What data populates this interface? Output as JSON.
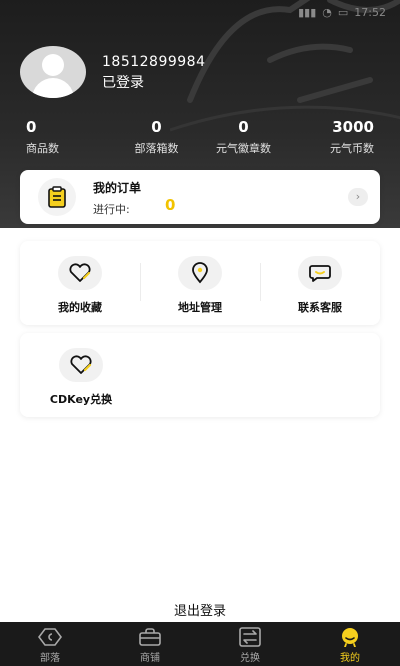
{
  "status": {
    "time": "17:52"
  },
  "profile": {
    "phone": "18512899984",
    "login_state": "已登录"
  },
  "stats": [
    {
      "value": "0",
      "label": "商品数"
    },
    {
      "value": "0",
      "label": "部落箱数"
    },
    {
      "value": "0",
      "label": "元气徽章数"
    },
    {
      "value": "3000",
      "label": "元气币数"
    }
  ],
  "order": {
    "title": "我的订单",
    "progress_label": "进行中:",
    "progress_count": "0"
  },
  "shortcuts": [
    {
      "label": "我的收藏",
      "icon": "heart-icon"
    },
    {
      "label": "地址管理",
      "icon": "location-pin-icon"
    },
    {
      "label": "联系客服",
      "icon": "chat-bubble-icon"
    }
  ],
  "cdkey": {
    "label": "CDKey兑换",
    "icon": "heart-icon"
  },
  "logout_label": "退出登录",
  "tabbar": [
    {
      "label": "部落",
      "icon": "tribe-icon",
      "active": false
    },
    {
      "label": "商铺",
      "icon": "shop-bag-icon",
      "active": false
    },
    {
      "label": "兑换",
      "icon": "exchange-icon",
      "active": false
    },
    {
      "label": "我的",
      "icon": "profile-icon",
      "active": true
    }
  ],
  "colors": {
    "accent": "#f5cf1e",
    "header_bg": "#222222",
    "tabbar_bg": "#1a1a1a"
  }
}
